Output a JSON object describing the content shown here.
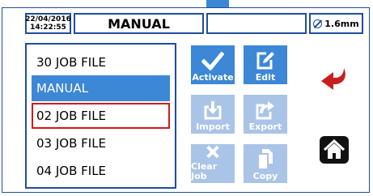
{
  "header": {
    "date": "22/04/2016",
    "time": "14:22:55",
    "mode": "MANUAL",
    "status": "",
    "size": "1.6mm"
  },
  "file_list": {
    "items": [
      {
        "label": "30 JOB FILE"
      },
      {
        "label": "MANUAL"
      },
      {
        "label": "02 JOB FILE"
      },
      {
        "label": "03 JOB FILE"
      },
      {
        "label": "04 JOB FILE"
      }
    ]
  },
  "buttons": {
    "activate": "Activate",
    "edit": "Edit",
    "import": "Import",
    "export": "Export",
    "clear_job": "Clear Job",
    "copy": "Copy"
  },
  "icons": {
    "activate": "checkmark-icon",
    "edit": "edit-icon",
    "import": "import-icon",
    "export": "export-icon",
    "clear_job": "x-icon",
    "copy": "copy-icon",
    "back": "back-arrow-icon",
    "home": "home-icon",
    "size": "diameter-icon"
  },
  "colors": {
    "accent": "#3c87d6",
    "disabled": "#a9c4e6",
    "border": "#1f4e9a",
    "highlight": "#d21a1a",
    "back_arrow": "#c81e1e"
  }
}
